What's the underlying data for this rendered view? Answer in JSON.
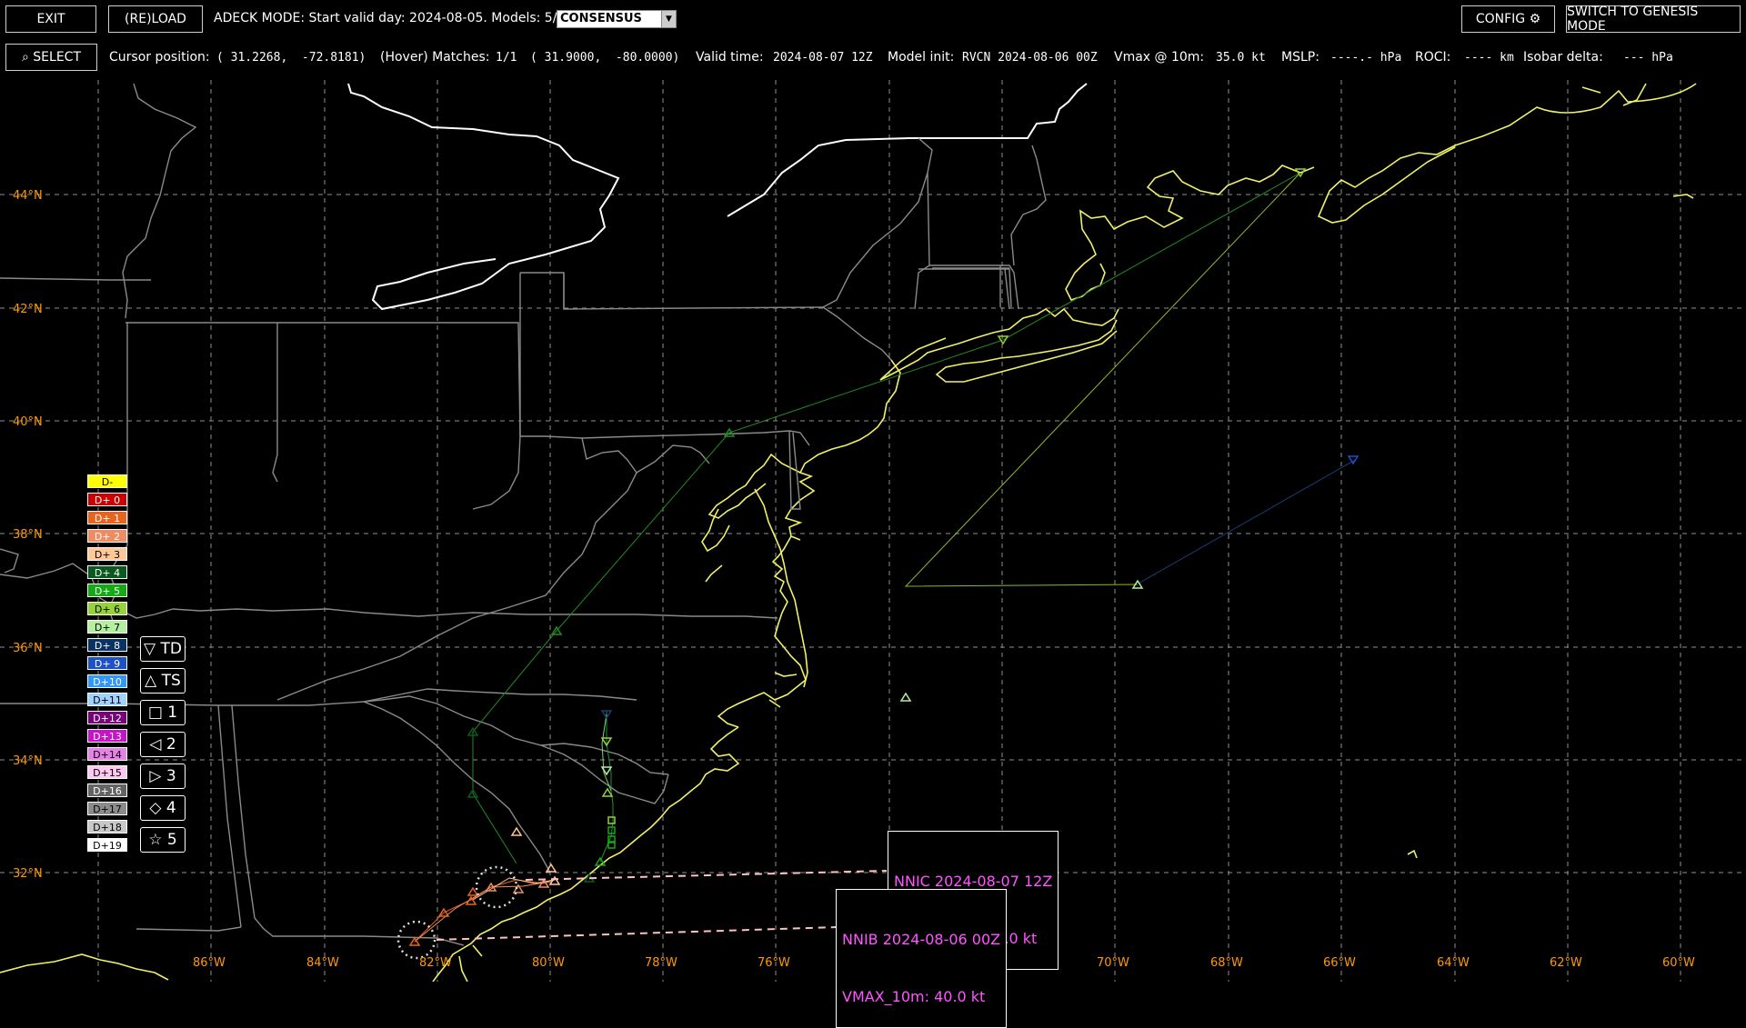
{
  "toolbar": {
    "exit_label": "EXIT",
    "reload_label": "(RE)LOAD",
    "mode_text": "ADECK MODE: Start valid day: 2024-08-05. Models: 5/77",
    "model_select_value": "CONSENSUS",
    "config_label": "CONFIG ⚙",
    "switch_label": "SWITCH TO GENESIS MODE"
  },
  "statusbar": {
    "select_label": "⌕ SELECT",
    "cursor_label": "Cursor position:",
    "cursor_value": "( 31.2268,  -72.8181)",
    "hover_label": "(Hover) Matches:",
    "hover_count": "1/1",
    "hover_pos": "( 31.9000,  -80.0000)",
    "valid_label": "Valid time:",
    "valid_value": "2024-08-07 12Z",
    "init_label": "Model init:",
    "init_value": "RVCN 2024-08-06 00Z",
    "vmax_label": "Vmax @ 10m:",
    "vmax_value": "35.0 kt",
    "mslp_label": "MSLP:",
    "mslp_value": "----.- hPa",
    "roci_label": "ROCI:",
    "roci_value": "---- km",
    "isobar_label": "Isobar delta:",
    "isobar_value": "--- hPa"
  },
  "map": {
    "lat_labels": [
      "44°N",
      "42°N",
      "40°N",
      "38°N",
      "36°N",
      "34°N",
      "32°N"
    ],
    "lon_labels": [
      "86°W",
      "84°W",
      "82°W",
      "80°W",
      "78°W",
      "76°W",
      "74°W",
      "72°W",
      "70°W",
      "68°W",
      "66°W",
      "64°W",
      "62°W",
      "60°W"
    ],
    "colors": {
      "coast": "#f0f06a",
      "border": "#a0a0a0",
      "state": "#808080",
      "grid": "#909090",
      "axis_label": "#ff9900"
    }
  },
  "legend": {
    "days": [
      {
        "label": "D-",
        "bg": "#ffff00",
        "fg": "#000000"
      },
      {
        "label": "D+ 0",
        "bg": "#cc0000",
        "fg": "#ffffff"
      },
      {
        "label": "D+ 1",
        "bg": "#e8641e",
        "fg": "#ffffff"
      },
      {
        "label": "D+ 2",
        "bg": "#f08c64",
        "fg": "#ffffff"
      },
      {
        "label": "D+ 3",
        "bg": "#ffc896",
        "fg": "#000000"
      },
      {
        "label": "D+ 4",
        "bg": "#0a5a1e",
        "fg": "#ffffff"
      },
      {
        "label": "D+ 5",
        "bg": "#14aa14",
        "fg": "#ffffff"
      },
      {
        "label": "D+ 6",
        "bg": "#96d23c",
        "fg": "#000000"
      },
      {
        "label": "D+ 7",
        "bg": "#b4f0a0",
        "fg": "#000000"
      },
      {
        "label": "D+ 8",
        "bg": "#0a3264",
        "fg": "#ffffff"
      },
      {
        "label": "D+ 9",
        "bg": "#1e50c8",
        "fg": "#ffffff"
      },
      {
        "label": "D+10",
        "bg": "#3296ff",
        "fg": "#ffffff"
      },
      {
        "label": "D+11",
        "bg": "#a0d2ff",
        "fg": "#000000"
      },
      {
        "label": "D+12",
        "bg": "#780078",
        "fg": "#ffffff"
      },
      {
        "label": "D+13",
        "bg": "#c814c8",
        "fg": "#ffffff"
      },
      {
        "label": "D+14",
        "bg": "#e682e6",
        "fg": "#000000"
      },
      {
        "label": "D+15",
        "bg": "#ffc8f0",
        "fg": "#000000"
      },
      {
        "label": "D+16",
        "bg": "#646464",
        "fg": "#ffffff"
      },
      {
        "label": "D+17",
        "bg": "#8c8c8c",
        "fg": "#000000"
      },
      {
        "label": "D+18",
        "bg": "#c8c8c8",
        "fg": "#000000"
      },
      {
        "label": "D+19",
        "bg": "#ffffff",
        "fg": "#000000"
      }
    ],
    "symbols": [
      "▽ TD",
      "△ TS",
      "□ 1",
      "◁ 2",
      "▷ 3",
      "◇ 4",
      "☆ 5"
    ]
  },
  "tooltips": [
    {
      "line1": "NNIC 2024-08-07 12Z",
      "line2": "VMAX_10m: 43.0 kt"
    },
    {
      "line1": "NNIB 2024-08-06 00Z",
      "line2": "VMAX_10m: 40.0 kt"
    }
  ]
}
